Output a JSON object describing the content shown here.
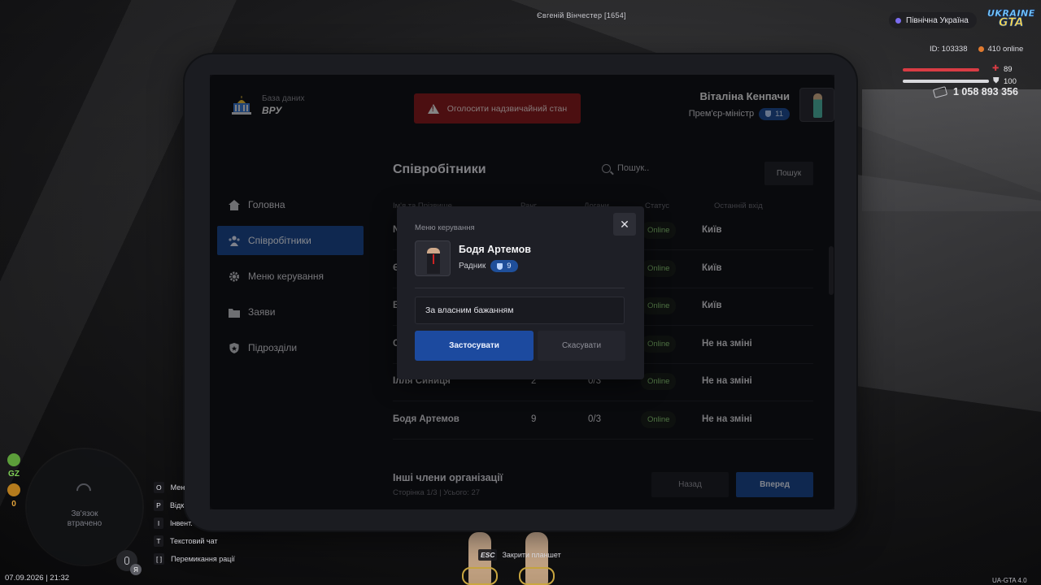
{
  "hud": {
    "player_label": "Євгеній Вінчестер [1654]",
    "region": "Північна Україна",
    "logo_line1": "UKRAINE",
    "logo_line2": "GTA",
    "id_text": "ID: 103338",
    "online_text": "410 online",
    "health": "89",
    "armor": "100",
    "health_level": 0.89,
    "armor_level": 1.0,
    "money": "1 058 893 356",
    "gz_label": "GZ",
    "counter_value": "0",
    "minimap_text_line1": "Зв'язок",
    "minimap_text_line2": "втрачено",
    "mic_badge": "Я",
    "keys": [
      {
        "key": "O",
        "label": "Мен"
      },
      {
        "key": "P",
        "label": "Відк"
      },
      {
        "key": "I",
        "label": "Інвент."
      },
      {
        "key": "T",
        "label": "Текстовий чат"
      },
      {
        "key": "[ ]",
        "label": "Перемикання рації"
      }
    ],
    "esc_key": "ESC",
    "esc_label": "Закрити планшет",
    "datetime": "07.09.2026 | 21:32",
    "version": "UA-GTA 4.0"
  },
  "tablet": {
    "brand_sub": "База даних",
    "brand_main": "ВРУ",
    "emergency_label": "Оголосити надзвичайний стан",
    "user": {
      "name": "Віталіна Кенпачи",
      "role": "Прем'єр-міністр",
      "rank": "11"
    },
    "sidebar": [
      {
        "label": "Головна",
        "icon": "home-icon"
      },
      {
        "label": "Співробітники",
        "icon": "users-icon",
        "active": true
      },
      {
        "label": "Меню керування",
        "icon": "gear-icon"
      },
      {
        "label": "Заяви",
        "icon": "folder-icon"
      },
      {
        "label": "Підрозділи",
        "icon": "shield-icon"
      }
    ],
    "employees": {
      "title": "Співробітники",
      "search_placeholder": "Пошук..",
      "search_button": "Пошук",
      "columns": [
        "Ім'я та Прізвище",
        "Ранг",
        "Догани",
        "Статус",
        "Останній вхід"
      ],
      "rows": [
        {
          "name": "N",
          "rank": "",
          "warns": "",
          "status": "Online",
          "last": "Київ"
        },
        {
          "name": "Є",
          "rank": "",
          "warns": "",
          "status": "Online",
          "last": "Київ"
        },
        {
          "name": "В",
          "rank": "",
          "warns": "",
          "status": "Online",
          "last": "Київ"
        },
        {
          "name": "С",
          "rank": "",
          "warns": "",
          "status": "Online",
          "last": "Не на зміні"
        },
        {
          "name": "Ілля Синиця",
          "rank": "2",
          "warns": "0/3",
          "status": "Online",
          "last": "Не на зміні"
        },
        {
          "name": "Бодя Артемов",
          "rank": "9",
          "warns": "0/3",
          "status": "Online",
          "last": "Не на зміні"
        }
      ],
      "footer_title": "Інші члени організації",
      "footer_sub": "Сторінка 1/3 | Усього: 27",
      "back_label": "Назад",
      "next_label": "Вперед"
    },
    "modal": {
      "label": "Меню керування",
      "name": "Бодя Артемов",
      "role": "Радник",
      "rank": "9",
      "reason_value": "За власним бажанням",
      "apply_label": "Застосувати",
      "cancel_label": "Скасувати"
    }
  }
}
